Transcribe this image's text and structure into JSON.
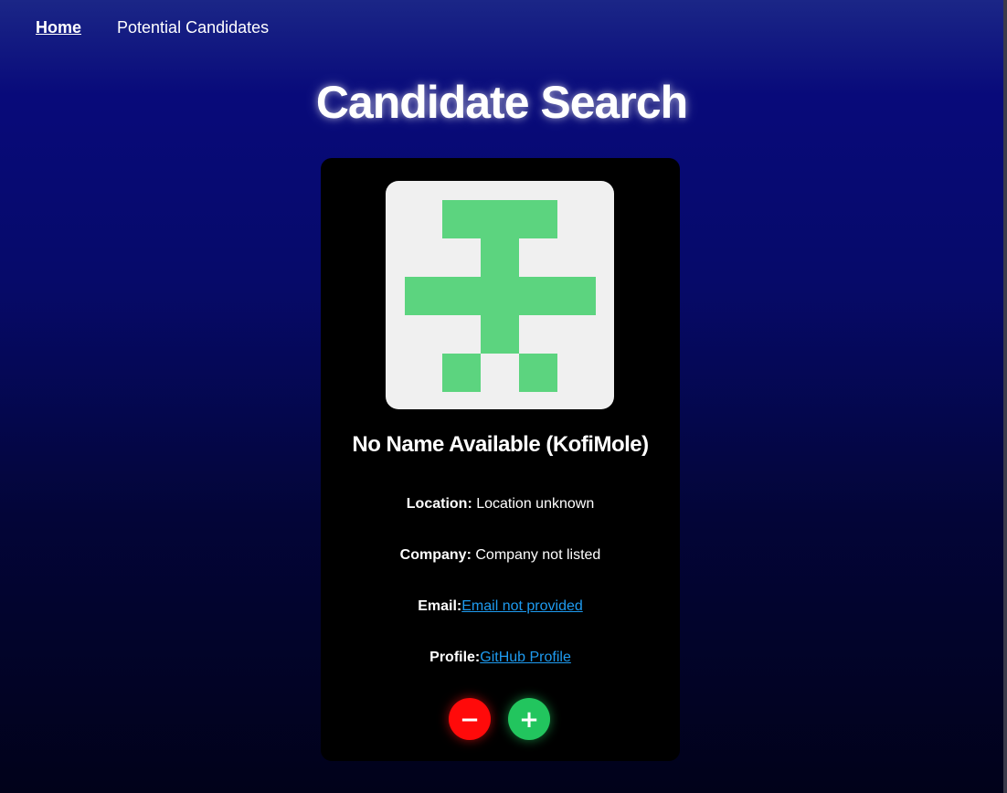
{
  "nav": {
    "items": [
      {
        "label": "Home",
        "active": true
      },
      {
        "label": "Potential Candidates",
        "active": false
      }
    ]
  },
  "page": {
    "title": "Candidate Search"
  },
  "candidate": {
    "avatar_color": "#5cd47f",
    "avatar_background": "#f0f0f0",
    "name": "No Name Available (KofiMole)",
    "location_label": "Location:",
    "location_value": "Location unknown",
    "company_label": "Company:",
    "company_value": "Company not listed",
    "email_label": "Email:",
    "email_value": "Email not provided",
    "profile_label": "Profile:",
    "profile_value": "GitHub Profile"
  },
  "actions": {
    "reject_symbol": "−",
    "reject_color": "#ff0a0a",
    "accept_symbol": "+",
    "accept_color": "#22c55e"
  }
}
